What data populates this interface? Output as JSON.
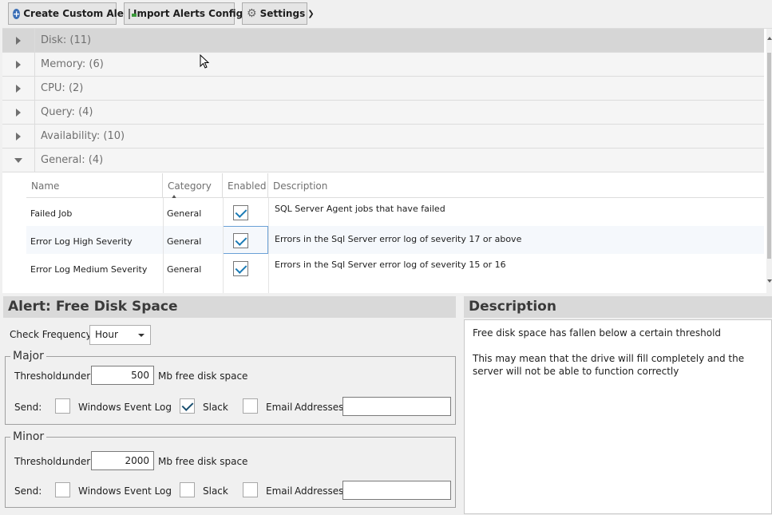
{
  "toolbar": {
    "create_label": "Create Custom Alert",
    "import_label": "Import Alerts Config",
    "settings_label": "Settings"
  },
  "groups": [
    {
      "label": "Disk: (11)",
      "expanded": false,
      "selected": true
    },
    {
      "label": "Memory: (6)",
      "expanded": false,
      "selected": false
    },
    {
      "label": "CPU: (2)",
      "expanded": false,
      "selected": false
    },
    {
      "label": "Query: (4)",
      "expanded": false,
      "selected": false
    },
    {
      "label": "Availability: (10)",
      "expanded": false,
      "selected": false
    },
    {
      "label": "General: (4)",
      "expanded": true,
      "selected": false
    }
  ],
  "table": {
    "columns": {
      "name": "Name",
      "category": "Category",
      "enabled": "Enabled",
      "description": "Description"
    },
    "rows": [
      {
        "name": "Failed Job",
        "category": "General",
        "enabled": true,
        "description": "SQL Server Agent jobs that have failed"
      },
      {
        "name": "Error Log High Severity",
        "category": "General",
        "enabled": true,
        "description": "Errors in the Sql Server error log of severity 17 or above"
      },
      {
        "name": "Error Log Medium Severity",
        "category": "General",
        "enabled": true,
        "description": "Errors in the Sql Server error log of severity 15 or 16"
      }
    ]
  },
  "alert": {
    "title_prefix": "Alert:",
    "title_name": "Free Disk Space",
    "check_frequency_label": "Check Frequency:",
    "check_frequency_value": "Hour",
    "major": {
      "legend": "Major",
      "threshold_label": "Threshold:",
      "under_label": "under",
      "threshold_value": "500",
      "unit_label": "Mb free disk space",
      "send_label": "Send:",
      "windows_event_log_label": "Windows Event Log",
      "windows_event_log_checked": false,
      "slack_label": "Slack",
      "slack_checked": true,
      "email_label": "Email",
      "email_checked": false,
      "addresses_label": "Addresses:",
      "addresses_value": ""
    },
    "minor": {
      "legend": "Minor",
      "threshold_label": "Threshold:",
      "under_label": "under",
      "threshold_value": "2000",
      "unit_label": "Mb free disk space",
      "send_label": "Send:",
      "windows_event_log_label": "Windows Event Log",
      "windows_event_log_checked": false,
      "slack_label": "Slack",
      "slack_checked": false,
      "email_label": "Email",
      "email_checked": false,
      "addresses_label": "Addresses:",
      "addresses_value": ""
    }
  },
  "description_panel": {
    "title": "Description",
    "line1": "Free disk space has fallen below a certain threshold",
    "line2": "This may mean that the drive will fill completely and the server will not be able to function correctly"
  }
}
